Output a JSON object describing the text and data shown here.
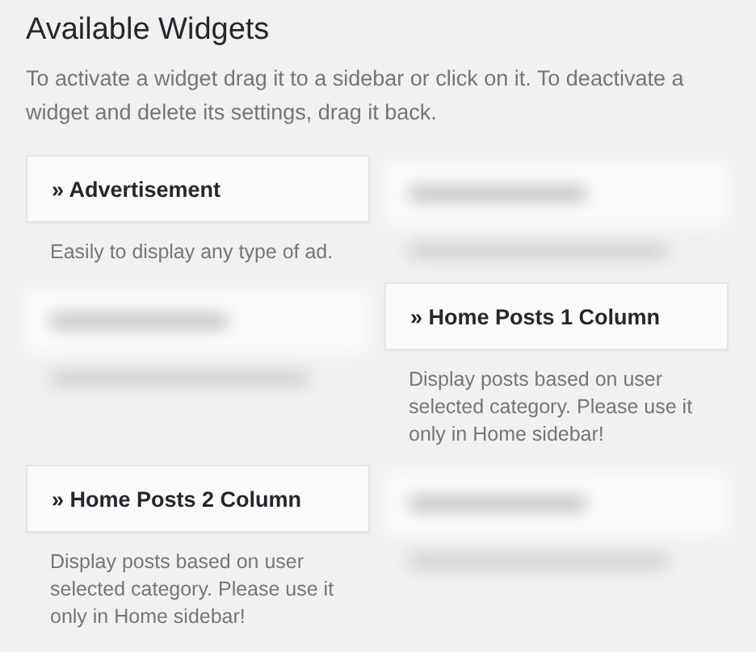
{
  "title": "Available Widgets",
  "description": "To activate a widget drag it to a sidebar or click on it. To deactivate a widget and delete its settings, drag it back.",
  "widgets": [
    {
      "kind": "widget",
      "name": "» Advertisement",
      "description": "Easily to display any type of ad."
    },
    {
      "kind": "blurred"
    },
    {
      "kind": "blurred"
    },
    {
      "kind": "widget",
      "name": "» Home Posts 1 Column",
      "description": "Display posts based on user selected category. Please use it only in Home sidebar!"
    },
    {
      "kind": "widget",
      "name": "» Home Posts 2 Column",
      "description": "Display posts based on user selected category. Please use it only in Home sidebar!"
    },
    {
      "kind": "blurred"
    }
  ]
}
